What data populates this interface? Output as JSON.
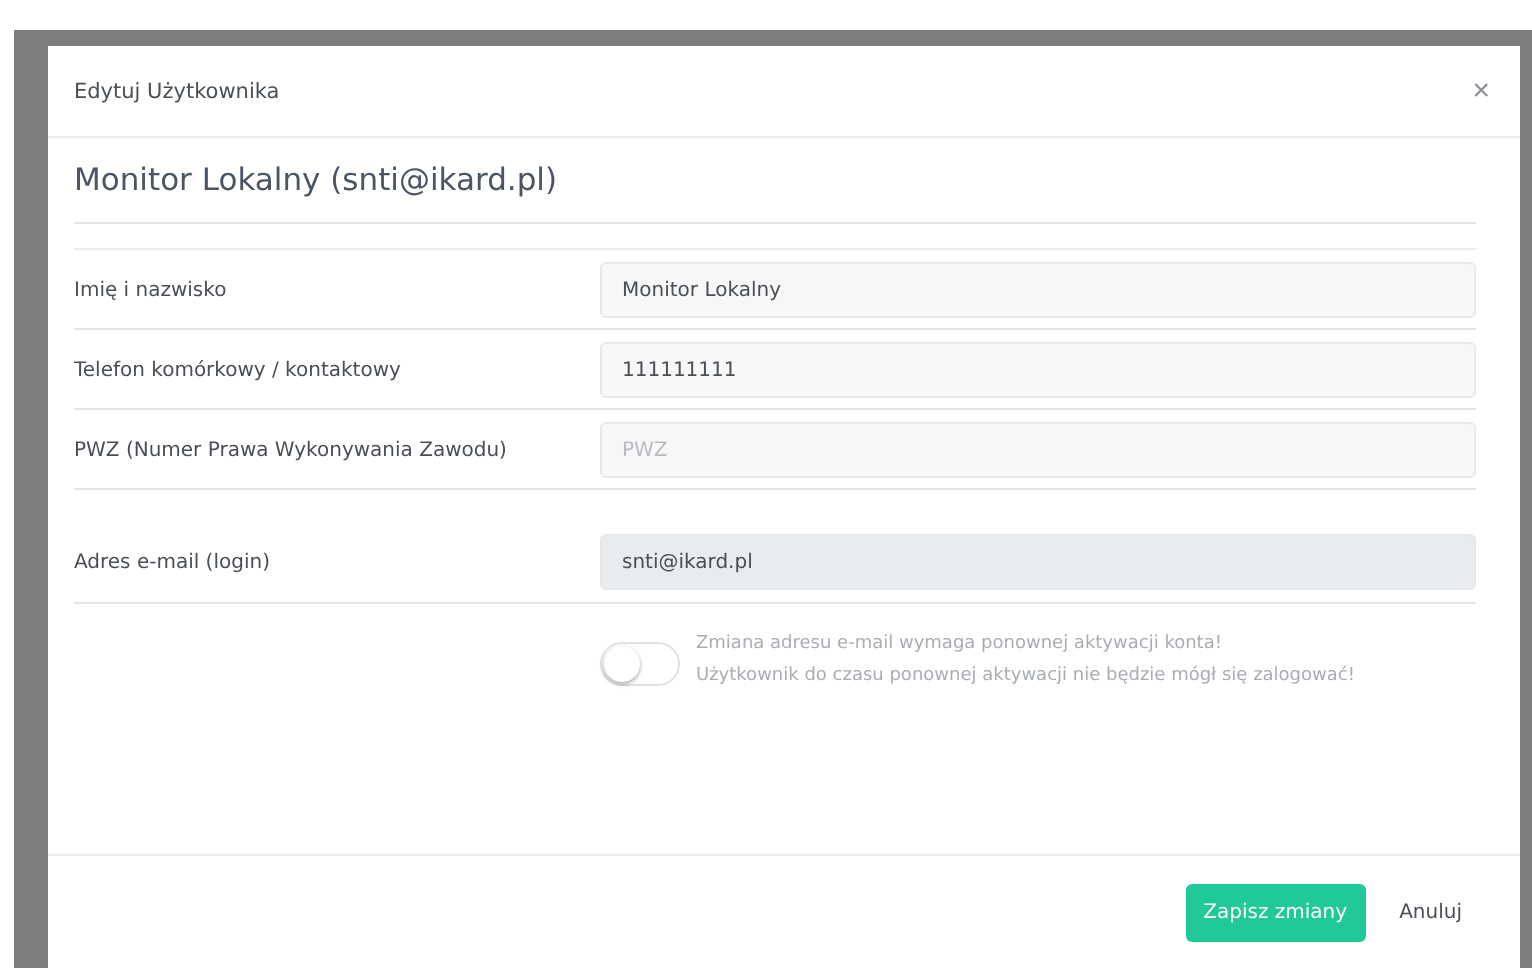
{
  "dialog": {
    "title": "Edytuj Użytkownika",
    "close": "×"
  },
  "heading": "Monitor Lokalny (snti@ikard.pl)",
  "fields": [
    {
      "label": "Imię i nazwisko",
      "value": "Monitor Lokalny",
      "disabled": false,
      "spaced": false
    },
    {
      "label": "Telefon komórkowy / kontaktowy",
      "value": "111111111",
      "disabled": false,
      "spaced": false
    },
    {
      "label": "PWZ (Numer Prawa Wykonywania Zawodu)",
      "placeholder": "PWZ",
      "disabled": false,
      "spaced": false
    },
    {
      "label": "Adres e-mail (login)",
      "value": "snti@ikard.pl",
      "disabled": true,
      "spaced": true
    }
  ],
  "email_change": {
    "on": false,
    "lines": [
      "Zmiana adresu e-mail wymaga ponownej aktywacji konta!",
      "Użytkownik do czasu ponownej aktywacji nie będzie mógł się zalogować!"
    ]
  },
  "buttons": [
    {
      "label": "Zapisz zmiany",
      "kind": "primary"
    },
    {
      "label": "Anuluj",
      "kind": "link"
    }
  ]
}
